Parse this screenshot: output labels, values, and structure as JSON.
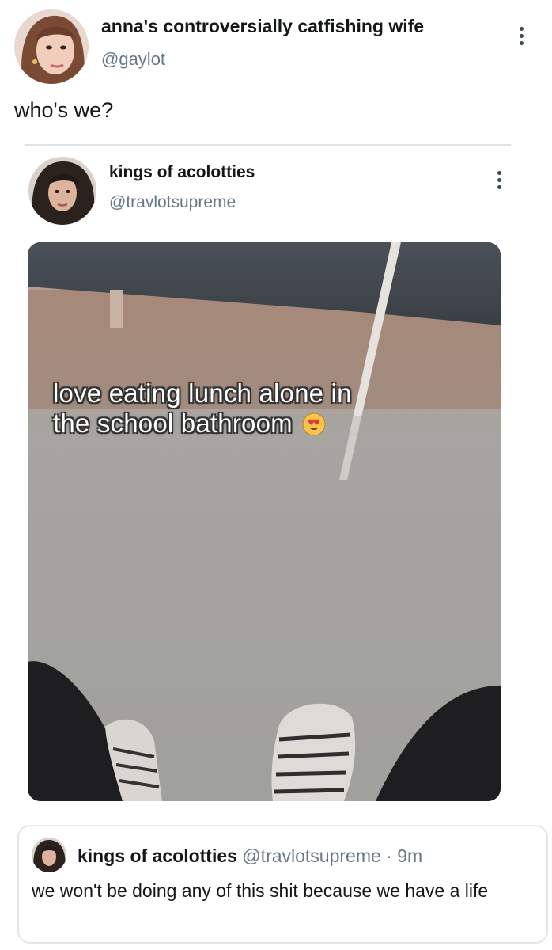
{
  "tweet": {
    "display_name": "anna's controversially catfishing wife",
    "handle": "@gaylot",
    "text": "who's we?"
  },
  "quoted_tweet": {
    "display_name": "kings of acolotties",
    "handle": "@travlotsupreme",
    "media_caption_line1": "love eating lunch alone in",
    "media_caption_line2": "the school bathroom"
  },
  "reply": {
    "display_name": "kings of acolotties",
    "meta": "@travlotsupreme · 9m",
    "text": "we won't be doing any of this shit because we have a life"
  },
  "icons": {
    "menu": "more-vertical-icon",
    "caption_emoji": "heart-eyes-emoji"
  },
  "colors": {
    "text_primary": "#14171a",
    "text_secondary": "#657786",
    "divider": "#dfe3e6"
  }
}
